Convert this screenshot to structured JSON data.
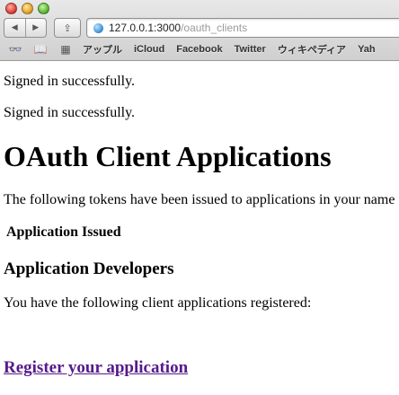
{
  "browser": {
    "url_host": "127.0.0.1:3000",
    "url_path": "/oauth_clients",
    "bookmarks": [
      "アップル",
      "iCloud",
      "Facebook",
      "Twitter",
      "ウィキペディア",
      "Yah"
    ]
  },
  "page": {
    "flash_messages": [
      "Signed in successfully.",
      "Signed in successfully."
    ],
    "title": "OAuth Client Applications",
    "intro": "The following tokens have been issued to applications in your name",
    "table_headers": [
      "Application",
      "Issued"
    ],
    "developers_heading": "Application Developers",
    "client_note": "You have the following client applications registered:",
    "register_link": "Register your application"
  },
  "colors": {
    "link_visited": "#551a8b",
    "url_path": "#9a9a9a"
  }
}
